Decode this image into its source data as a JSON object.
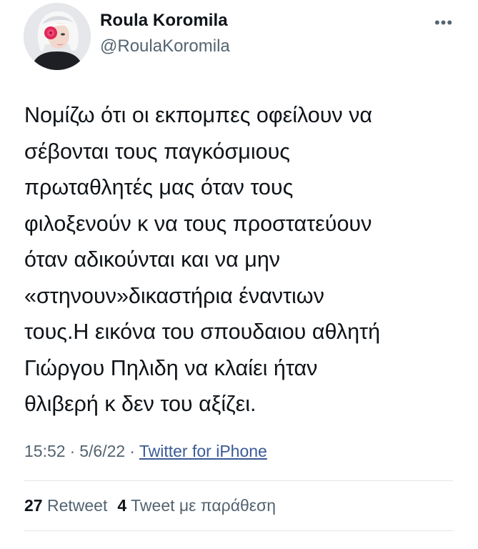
{
  "author": {
    "name": "Roula Koromila",
    "handle": "@RoulaKoromila",
    "avatar_icon": "profile-photo"
  },
  "more_icon": "more-horizontal-icon",
  "more_glyph": "•••",
  "tweet": {
    "lines": [
      "Νομίζω ότι οι εκπομπες οφείλουν να",
      "σέβονται τους παγκόσμιους",
      "πρωταθλητές μας όταν τους",
      "φιλοξενούν κ να τους προστατεύουν",
      "όταν αδικούνται και να μην",
      "«στηνουν»δικαστήρια έναντιων",
      "τους.Η εικόνα του σπουδαιου αθλητή",
      "Γιώργου Πηλιδη να κλαίει ήταν",
      "θλιβερή κ δεν του αξίζει."
    ]
  },
  "meta": {
    "time": "15:52",
    "separator": "·",
    "date": "5/6/22",
    "source": "Twitter for iPhone"
  },
  "stats": {
    "retweets_count": "27",
    "retweets_label": "Retweet",
    "quotes_count": "4",
    "quotes_label": "Tweet με παράθεση"
  },
  "colors": {
    "text": "#0f1419",
    "secondary": "#536471",
    "link": "#3b5a96",
    "divider": "#e3e7ea"
  }
}
